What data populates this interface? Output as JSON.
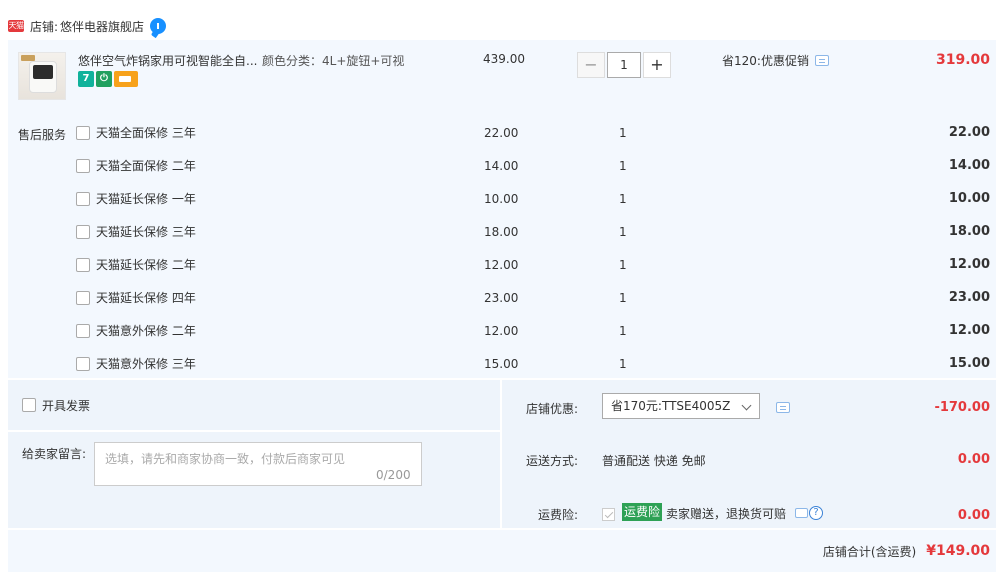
{
  "store": {
    "badge": "天猫",
    "label": "店铺:",
    "name": "悠伴电器旗舰店"
  },
  "product": {
    "title": "悠伴空气炸锅家用可视智能全自...",
    "sku": "颜色分类：4L+旋钮+可视",
    "unit_price": "439.00",
    "quantity": "1",
    "promo": "省120:优惠促销",
    "total": "319.00",
    "badges": [
      "seven-icon",
      "plug-icon",
      "card-icon"
    ]
  },
  "services": {
    "label": "售后服务",
    "rows": [
      {
        "name": "天猫全面保修 三年",
        "price": "22.00",
        "qty": "1",
        "sub": "22.00"
      },
      {
        "name": "天猫全面保修 二年",
        "price": "14.00",
        "qty": "1",
        "sub": "14.00"
      },
      {
        "name": "天猫延长保修 一年",
        "price": "10.00",
        "qty": "1",
        "sub": "10.00"
      },
      {
        "name": "天猫延长保修 三年",
        "price": "18.00",
        "qty": "1",
        "sub": "18.00"
      },
      {
        "name": "天猫延长保修 二年",
        "price": "12.00",
        "qty": "1",
        "sub": "12.00"
      },
      {
        "name": "天猫延长保修 四年",
        "price": "23.00",
        "qty": "1",
        "sub": "23.00"
      },
      {
        "name": "天猫意外保修 二年",
        "price": "12.00",
        "qty": "1",
        "sub": "12.00"
      },
      {
        "name": "天猫意外保修 三年",
        "price": "15.00",
        "qty": "1",
        "sub": "15.00"
      }
    ]
  },
  "invoice": {
    "label": "开具发票"
  },
  "message": {
    "label": "给卖家留言:",
    "placeholder": "选填，请先和商家协商一致，付款后商家可见",
    "counter": "0/200"
  },
  "store_discount": {
    "label": "店铺优惠:",
    "selected": "省170元:TTSE4005Z",
    "value": "-170.00"
  },
  "shipping": {
    "label": "运送方式:",
    "value": "普通配送 快递 免邮",
    "amount": "0.00"
  },
  "insurance": {
    "label": "运费险:",
    "tag": "运费险",
    "desc": "卖家赠送，退换货可赔",
    "amount": "0.00"
  },
  "footer": {
    "label": "店铺合计(含运费)",
    "amount": "¥149.00"
  },
  "colors": {
    "accent_red": "#e4393c",
    "panel_bg": "#f3f8fe",
    "tmall_red": "#e4393c",
    "insurance_green": "#2ea155"
  }
}
